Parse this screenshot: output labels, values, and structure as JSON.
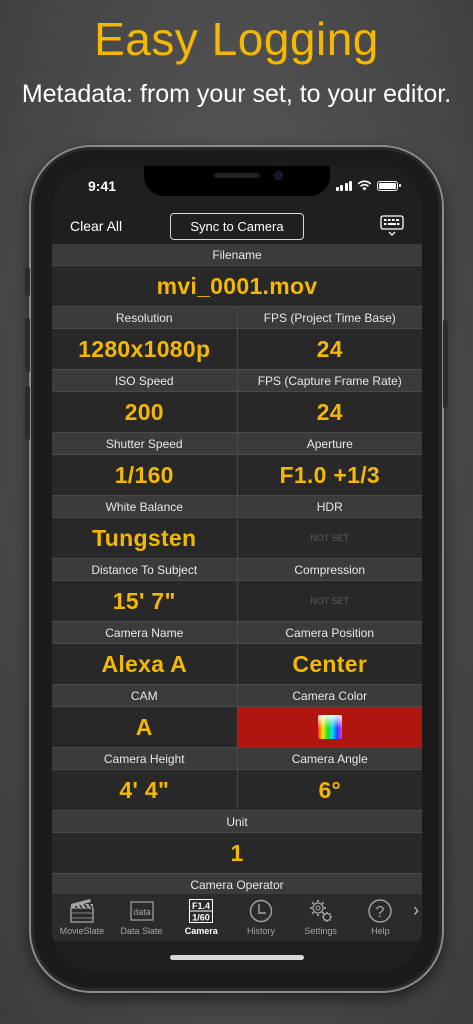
{
  "marketing": {
    "headline": "Easy Logging",
    "subhead": "Metadata: from your set, to your editor."
  },
  "status_bar": {
    "time": "9:41"
  },
  "toolbar": {
    "clear_label": "Clear All",
    "sync_label": "Sync to Camera"
  },
  "fields": {
    "filename": {
      "label": "Filename",
      "value": "mvi_0001.mov"
    },
    "resolution": {
      "label": "Resolution",
      "value": "1280x1080p"
    },
    "fps_project": {
      "label": "FPS (Project Time Base)",
      "value": "24"
    },
    "iso": {
      "label": "ISO Speed",
      "value": "200"
    },
    "fps_capture": {
      "label": "FPS (Capture Frame Rate)",
      "value": "24"
    },
    "shutter": {
      "label": "Shutter Speed",
      "value": "1/160"
    },
    "aperture": {
      "label": "Aperture",
      "value": "F1.0 +1/3"
    },
    "white_balance": {
      "label": "White Balance",
      "value": "Tungsten"
    },
    "hdr": {
      "label": "HDR",
      "value": "NOT SET"
    },
    "distance": {
      "label": "Distance To Subject",
      "value": "15' 7\""
    },
    "compression": {
      "label": "Compression",
      "value": "NOT SET"
    },
    "camera_name": {
      "label": "Camera Name",
      "value": "Alexa A"
    },
    "camera_position": {
      "label": "Camera Position",
      "value": "Center"
    },
    "cam": {
      "label": "CAM",
      "value": "A"
    },
    "camera_color": {
      "label": "Camera Color",
      "value": "#b01510"
    },
    "camera_height": {
      "label": "Camera Height",
      "value": "4' 4\""
    },
    "camera_angle": {
      "label": "Camera Angle",
      "value": "6°"
    },
    "unit": {
      "label": "Unit",
      "value": "1"
    },
    "camera_operator": {
      "label": "Camera Operator"
    }
  },
  "tabs": [
    {
      "label": "MovieSlate",
      "icon": "clapperboard-icon"
    },
    {
      "label": "Data Slate",
      "icon": "data-slate-icon",
      "icon_text": "data"
    },
    {
      "label": "Camera",
      "icon": "camera-exposure-icon",
      "icon_text_top": "F1.4",
      "icon_text_bottom": "1/60",
      "active": true
    },
    {
      "label": "History",
      "icon": "clock-icon"
    },
    {
      "label": "Settings",
      "icon": "gears-icon"
    },
    {
      "label": "Help",
      "icon": "help-icon",
      "icon_text": "?"
    }
  ],
  "colors": {
    "accent": "#f5b800",
    "label_bg": "#3b3b3b",
    "value_bg": "#282828"
  }
}
